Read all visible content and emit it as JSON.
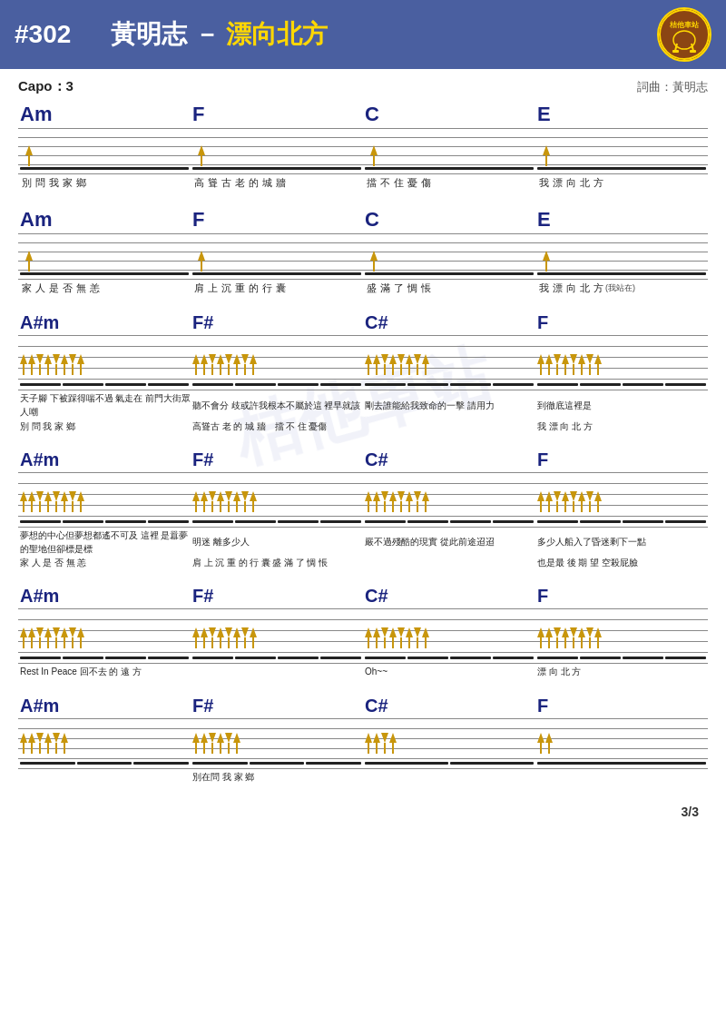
{
  "header": {
    "number": "#302",
    "artist": "黃明志",
    "separator": " － ",
    "title": "漂向北方",
    "capo": "Capo：3",
    "composer": "詞曲：黃明志",
    "page": "3/3"
  },
  "watermark": "桔他車站",
  "sections": [
    {
      "id": "s1",
      "chords": [
        "Am",
        "F",
        "C",
        "E"
      ],
      "simple": true,
      "lyrics": [
        [
          "別",
          "問",
          "我",
          "家",
          "鄉"
        ],
        [
          "高",
          "聳",
          "古",
          "老",
          "的",
          "城",
          "牆"
        ],
        [
          "擋",
          "不",
          "住",
          "憂",
          "傷"
        ],
        [
          "我",
          "漂",
          "向",
          "北",
          "方"
        ]
      ]
    },
    {
      "id": "s2",
      "chords": [
        "Am",
        "F",
        "C",
        "E"
      ],
      "simple": true,
      "lyrics": [
        [
          "家",
          "人",
          "是",
          "否",
          "無",
          "恙"
        ],
        [
          "肩",
          "上",
          "沉",
          "重",
          "的",
          "行",
          "囊"
        ],
        [
          "盛",
          "滿",
          "了",
          "惆",
          "悵"
        ],
        [
          "我",
          "漂",
          "向",
          "北",
          "方",
          "(我站在)"
        ]
      ]
    },
    {
      "id": "s3",
      "chords": [
        "A#m",
        "F#",
        "C#",
        "F"
      ],
      "simple": false,
      "lyrics": [
        [
          "天子腳 下被踩得喘不過 氣走在 前門大街眾人嘲 聽不會分 歧或許我根本不屬於這 裡早就該 剛去誰能給我致命的一擊 請用力 到徹底這裡是",
          "別 問 我 家 鄉"
        ],
        [
          "我 漂 向 北 方",
          "高聳古 老 的 城 牆 擋 不 住 憂傷"
        ]
      ]
    },
    {
      "id": "s4",
      "chords": [
        "A#m",
        "F#",
        "C#",
        "F"
      ],
      "simple": false,
      "lyrics": [
        [
          "夢想的中心但夢想都遙不可及 這裡 是囂夢的聖地但卻標是標 明迷 離多少人",
          "嚴不過殘酷的現實 從此前途迢迢 多少人船入了昏迷剩下一點"
        ],
        [
          "家 人 是 否 無 恙",
          "肩 上 沉 重 的 行 囊 盛 滿 了 惆 悵",
          "也是最 後 期 望 空殺屁臉"
        ]
      ]
    },
    {
      "id": "s5",
      "chords": [
        "A#m",
        "F#",
        "C#",
        "F"
      ],
      "simple": false,
      "lyrics": [
        [
          "Rest In Peace 回不去 的 遠 方"
        ],
        [
          "Oh~~"
        ],
        [
          "漂 向 北 方"
        ]
      ]
    },
    {
      "id": "s6",
      "chords": [
        "A#m",
        "F#",
        "C#",
        "F"
      ],
      "simple": false,
      "lyrics": [
        [
          "別在問 我 家 鄉"
        ]
      ]
    }
  ]
}
